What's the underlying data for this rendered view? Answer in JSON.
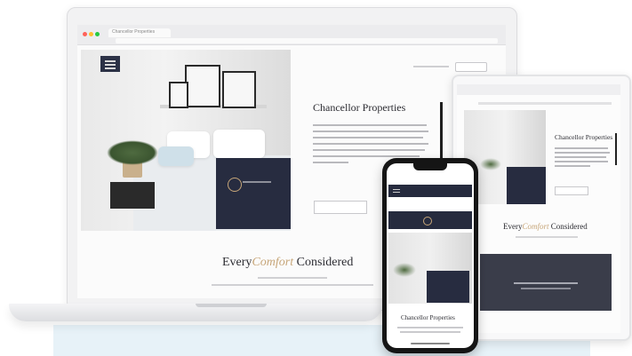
{
  "laptop": {
    "tab_title": "Chancellor Properties",
    "site": {
      "heading": "Chancellor Properties",
      "tagline_prefix": "Every",
      "tagline_accent": "Comfort",
      "tagline_suffix": "Considered"
    }
  },
  "tablet": {
    "heading": "Chancellor Properties",
    "tagline_prefix": "Every",
    "tagline_accent": "Comfort",
    "tagline_suffix": "Considered"
  },
  "phone": {
    "heading": "Chancellor Properties"
  },
  "colors": {
    "navy": "#272c40",
    "accent_gold": "#c7a679",
    "page_bg": "#fbfbfb",
    "shadow_tint": "#e7f2f8"
  },
  "icons": [
    "menu-icon"
  ]
}
